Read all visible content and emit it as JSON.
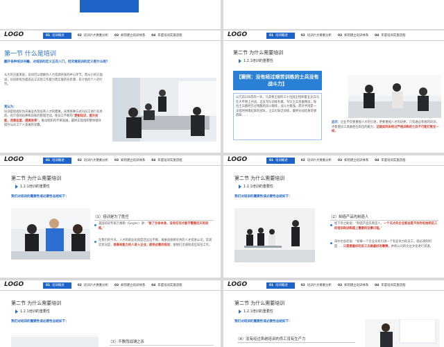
{
  "nav": {
    "logo": "LOGO",
    "items": [
      {
        "num": "01",
        "label": "培训概述"
      },
      {
        "num": "02",
        "label": "培训六大要素分析"
      },
      {
        "num": "03",
        "label": "如何建立培训体系"
      },
      {
        "num": "04",
        "label": "年度培训实施流程"
      }
    ]
  },
  "slide1": {
    "title": "第一节  什么是培训",
    "question": "翻开各种培训书籍，对培训的定义五花八门，但究竟培训的定义是什么呢？",
    "p1": "从大的方面来说，培训可以理解为人力资源开发的中心环节，而从小的方面说，培训即指为提高员工实际工作能力而实施的有步骤、有计划的个人的行为。",
    "p2_label": "我认为：",
    "p2": "培训是指组织为开展业务及培育人才的需要，采用各种方式对员工进行有目的、有计划的培养和训练的管理活动，使员工不断的“",
    "p2_hl": "更新知识，提升技能，改善态度，提高效率",
    "p2_end": "”，推动组织的不断发展，最终实现组织整体绩效提升与员工个人发展的双赢。"
  },
  "slide2": {
    "title": "第二节  为什么需要培训",
    "sub": "1.2.1培训的重要性",
    "case": "【案例：没有经过艰苦训练的士兵没有战斗力】",
    "case_text": "公元前136年的一天，马其顿王国的三十位国王指挥着五支兵马在大平原上开战。这支军队训练有素，军队士兵装备精良，每位士兵都经历过残酷的战斗锤炼，战斗力极强，而对手则是一支临时拼凑起来的部队，士兵们缺乏训练，最终对战结果可想而知……",
    "side_label": "启示：",
    "side_text": "企业不仅要重视人才的引进，更要重视人才的培养，只有通过系统的培训，才能使员工具备胜任岗位的能力，",
    "side_hl": "这就如同未经过严格训练的士兵不可能打胜仗一样。"
  },
  "slide3": {
    "title": "第二节  为什么需要培训",
    "sub": "1.2.1培训的重要性",
    "q": "我们对培训的重要性或必要性总结如下：",
    "item": "（1）培训是为了胜任",
    "b1": "美国培训专家吉格勒（Gegler）讲：“",
    "b1_hl": "致了生命本身，没有任何才能不需要后天的训练。",
    "b1_end": "”",
    "b2": "在我们的今天，人才的职业化程度还远远不够，很难直接将优秀的人才招进公司，其现实状况是，",
    "b2_hl": "很难有能力的人进入企业，提供必要的培训",
    "b2_end": "，使他们迅速地适应岗位工作。"
  },
  "slide4": {
    "title": "第二节  为什么需要培训",
    "sub": "1.2.1培训的重要性",
    "q": "我们对培训的重要性或必要性总结如下：",
    "item": "（2）制造产品先制造人",
    "b1": "松下幸之助说：“制造产品先制造人，",
    "b1_hl": "一个天才的企业家总是不失时机地把员工的培训和训练摆上重要的议事日程。",
    "b1_end": "”",
    "b2": "海尔也总结说：“如果一个企业光有引进一个有竞争力的员工，就必须的制度……",
    "b2_hl": "只是要最好的员工去做最好的事情，",
    "b2_end": "并将公司的企业文化进行渗透。"
  },
  "slide5": {
    "title": "第二节  为什么需要培训",
    "sub": "1.2.1培训的重要性",
    "q": "我们对培训的重要性或必要性总结如下：",
    "item": "（3）不教而战谓之杀"
  },
  "slide6": {
    "title": "第二节  为什么需要培训",
    "sub": "1.2.1培训的重要性",
    "q": "我们对培训的重要性或必要性总结如下：",
    "item": "（4）没有经过系统培训的员工没有生产力"
  }
}
